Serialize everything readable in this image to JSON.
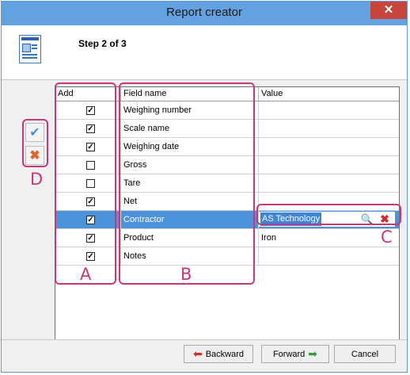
{
  "window": {
    "title": "Report creator",
    "close_label": "✕"
  },
  "header": {
    "step_text": "Step 2 of 3"
  },
  "side_tools": {
    "check_all_icon": "check-icon",
    "uncheck_all_icon": "cross-icon"
  },
  "grid": {
    "columns": {
      "add": "Add",
      "field_name": "Field name",
      "value": "Value"
    },
    "rows": [
      {
        "checked": true,
        "name": "Weighing number",
        "value": ""
      },
      {
        "checked": true,
        "name": "Scale name",
        "value": ""
      },
      {
        "checked": true,
        "name": "Weighing date",
        "value": ""
      },
      {
        "checked": false,
        "name": "Gross",
        "value": ""
      },
      {
        "checked": false,
        "name": "Tare",
        "value": ""
      },
      {
        "checked": true,
        "name": "Net",
        "value": ""
      },
      {
        "checked": true,
        "name": "Contractor",
        "value": "AS Technology"
      },
      {
        "checked": true,
        "name": "Product",
        "value": "Iron"
      },
      {
        "checked": true,
        "name": "Notes",
        "value": ""
      }
    ],
    "selected_row": 6
  },
  "annotations": {
    "a": "A",
    "b": "B",
    "c": "C",
    "d": "D"
  },
  "footer": {
    "backward": "Backward",
    "forward": "Forward",
    "cancel": "Cancel"
  },
  "colors": {
    "title_bar": "#63a1e1",
    "selection": "#4c93d9",
    "annotation": "#c7377b",
    "close": "#c7453d"
  }
}
